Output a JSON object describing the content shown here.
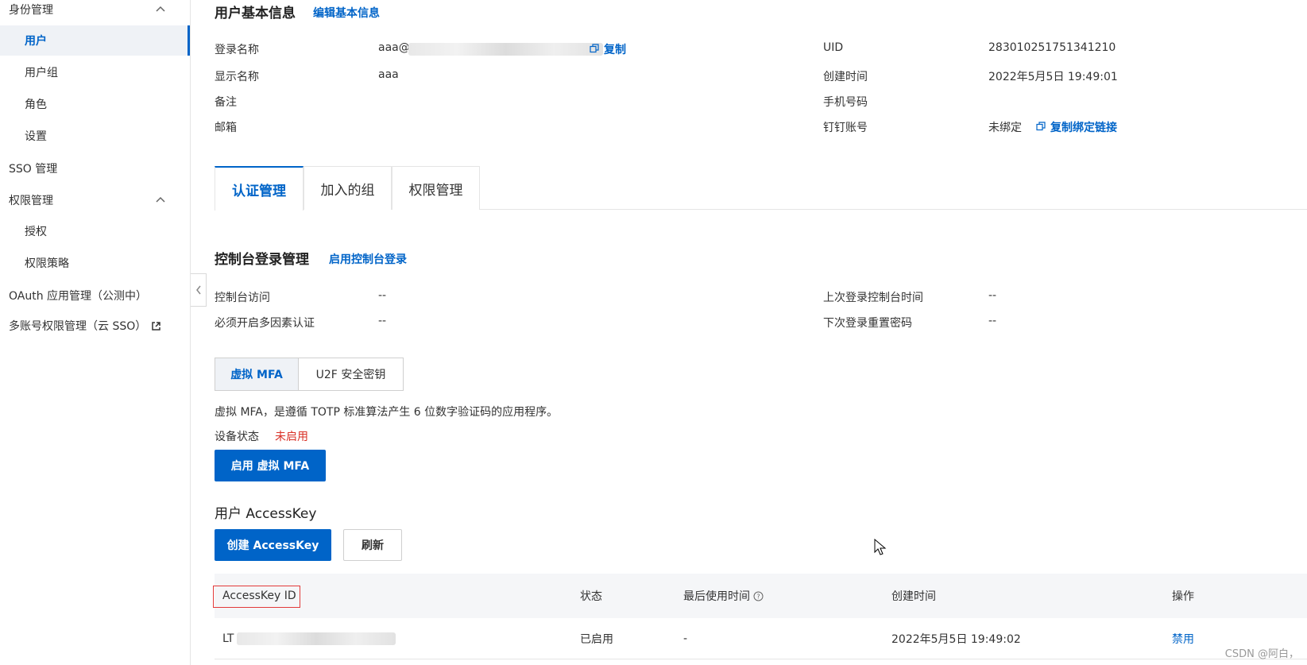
{
  "sidebar": {
    "identity_group": "身份管理",
    "items": {
      "users": "用户",
      "user_groups": "用户组",
      "roles": "角色",
      "settings": "设置"
    },
    "sso": "SSO 管理",
    "permission_group": "权限管理",
    "perm_items": {
      "grant": "授权",
      "policies": "权限策略"
    },
    "oauth": "OAuth 应用管理（公测中）",
    "multi_account": "多账号权限管理（云 SSO）"
  },
  "basic_info": {
    "title": "用户基本信息",
    "edit_link": "编辑基本信息",
    "login_name_label": "登录名称",
    "login_name_value": "aaa@",
    "copy_link": "复制",
    "display_name_label": "显示名称",
    "display_name_value": "aaa",
    "remark_label": "备注",
    "email_label": "邮箱",
    "uid_label": "UID",
    "uid_value": "283010251751341210",
    "created_label": "创建时间",
    "created_value": "2022年5月5日 19:49:01",
    "phone_label": "手机号码",
    "dingtalk_label": "钉钉账号",
    "dingtalk_value": "未绑定",
    "copy_bind_link": "复制绑定链接"
  },
  "tabs": [
    "认证管理",
    "加入的组",
    "权限管理"
  ],
  "console": {
    "title": "控制台登录管理",
    "enable_link": "启用控制台登录",
    "access_label": "控制台访问",
    "access_value": "--",
    "mfa_required_label": "必须开启多因素认证",
    "mfa_required_value": "--",
    "last_login_label": "上次登录控制台时间",
    "last_login_value": "--",
    "reset_pwd_label": "下次登录重置密码",
    "reset_pwd_value": "--"
  },
  "mfa": {
    "seg_virtual": "虚拟 MFA",
    "seg_u2f": "U2F 安全密钥",
    "description": "虚拟 MFA，是遵循 TOTP 标准算法产生 6 位数字验证码的应用程序。",
    "status_label": "设备状态",
    "status_value": "未启用",
    "enable_button": "启用 虚拟 MFA"
  },
  "accesskey": {
    "title": "用户 AccessKey",
    "create_button": "创建 AccessKey",
    "refresh_button": "刷新",
    "columns": {
      "id": "AccessKey ID",
      "status": "状态",
      "last_used": "最后使用时间",
      "created": "创建时间",
      "action": "操作"
    },
    "rows": [
      {
        "id_prefix": "LT",
        "status": "已启用",
        "last_used": "-",
        "created": "2022年5月5日 19:49:02",
        "action": "禁用"
      }
    ]
  },
  "watermark": "CSDN @阿白，",
  "colors": {
    "primary": "#0064c8",
    "danger": "#d93026",
    "active_bg": "#eff2f6"
  }
}
